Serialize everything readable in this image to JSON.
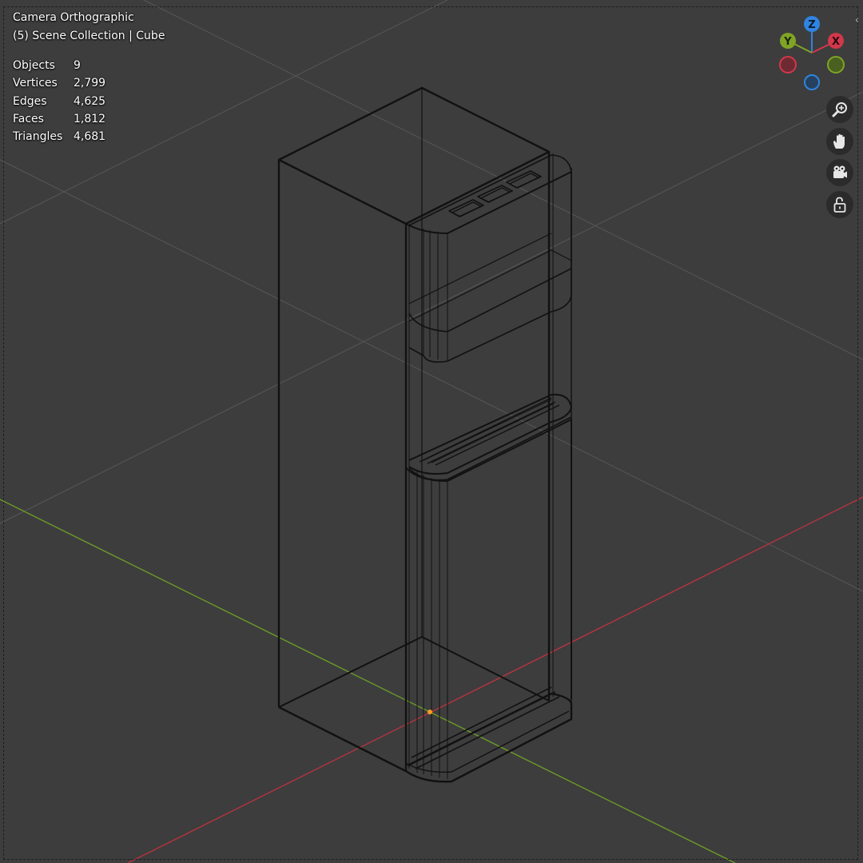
{
  "viewport": {
    "view_name": "Camera Orthographic",
    "collection": "(5) Scene Collection | Cube",
    "background_color": "#3d3d3d"
  },
  "stats": [
    {
      "label": "Objects",
      "value": "9"
    },
    {
      "label": "Vertices",
      "value": "2,799"
    },
    {
      "label": "Edges",
      "value": "4,625"
    },
    {
      "label": "Faces",
      "value": "1,812"
    },
    {
      "label": "Triangles",
      "value": "4,681"
    }
  ],
  "gizmo": {
    "z_label": "Z",
    "y_label": "Y",
    "x_label": "X",
    "x_color": "#d0384b",
    "y_color": "#7fa425",
    "z_color": "#2f84e0"
  },
  "nav_buttons": {
    "zoom_icon": "zoom-icon",
    "pan_icon": "hand-icon",
    "camera_icon": "camera-icon",
    "lock_icon": "unlock-icon"
  },
  "scene": {
    "object_name": "Cube",
    "x_axis_color": "#b5343f",
    "y_axis_color": "#6a9a28",
    "grid_color": "#585858",
    "wire_color": "#111111",
    "origin_color": "#ff9b22"
  }
}
